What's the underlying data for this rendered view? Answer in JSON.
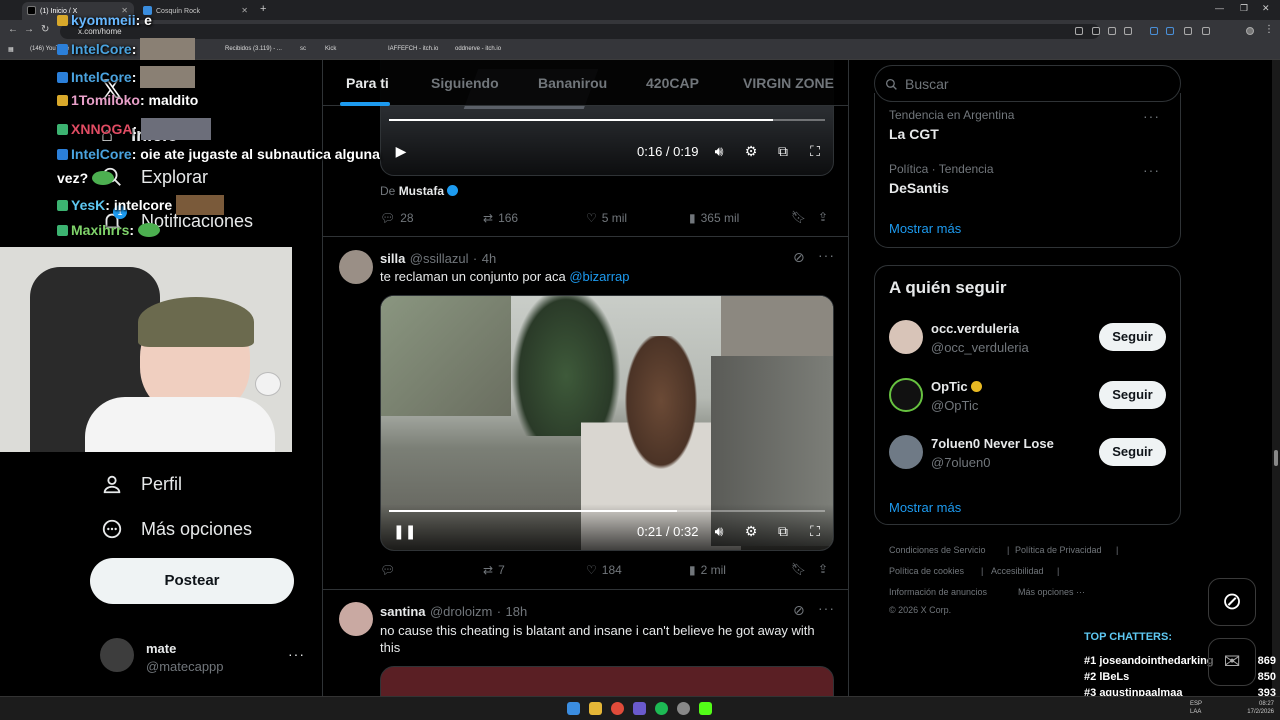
{
  "browser": {
    "tabs": [
      {
        "label": "(1) Inicio / X",
        "active": true
      },
      {
        "label": "Cosquín Rock",
        "active": false
      }
    ],
    "url": "x.com/home",
    "bookmarks": [
      "(146) YouTube",
      "Recibidos (3.119) - ...",
      "sc",
      "Kick",
      "IAFFEFCH - itch.io",
      "oddnerve - itch.io"
    ]
  },
  "chat_overlay": {
    "lines": [
      {
        "user": "kyommeii",
        "msg": "e"
      },
      {
        "user": "IntelCore",
        "msg": ""
      },
      {
        "user": "IntelCore",
        "msg": ""
      },
      {
        "user": "1Tomiloko",
        "msg": "maldito"
      },
      {
        "user": "XNNOGA",
        "msg": ""
      },
      {
        "user": "IntelCore",
        "msg": "oie ate jugaste al subnautica alguna"
      },
      {
        "user": "",
        "msg": "vez?"
      },
      {
        "user": "YesK",
        "msg": "intelcore"
      },
      {
        "user": "Maxihrrs",
        "msg": ""
      }
    ]
  },
  "left_nav": {
    "items": [
      {
        "label": "Inicio"
      },
      {
        "label": "Explorar"
      },
      {
        "label": "Notificaciones",
        "badge": "1"
      },
      {
        "label": "Perfil"
      },
      {
        "label": "Más opciones"
      }
    ],
    "post_button": "Postear",
    "account": {
      "name": "mate",
      "handle": "@matecappp"
    }
  },
  "feed_tabs": [
    "Para ti",
    "Siguiendo",
    "Bananirou",
    "420CAP",
    "VIRGIN ZONE"
  ],
  "tweets": [
    {
      "source": "De",
      "source_name": "Mustafa",
      "video": {
        "time": "0:16 / 0:19",
        "progress": 0.88
      },
      "replies": "28",
      "reposts": "166",
      "likes": "5 mil",
      "views": "365 mil"
    },
    {
      "name": "silla",
      "handle": "@ssillazul",
      "time": "4h",
      "text": "te reclaman un conjunto por aca ",
      "mention": "@bizarrap",
      "video": {
        "time": "0:21 / 0:32",
        "progress": 0.66
      },
      "replies": "",
      "reposts": "7",
      "likes": "184",
      "views": "2 mil"
    },
    {
      "name": "santina",
      "handle": "@droloizm",
      "time": "18h",
      "text": "no cause this cheating is blatant and insane i can't believe he got away with this"
    }
  ],
  "right_sidebar": {
    "search_placeholder": "Buscar",
    "trends": [
      {
        "meta": "Tendencia en Argentina",
        "name": "La CGT"
      },
      {
        "meta": "Política · Tendencia",
        "name": "DeSantis"
      }
    ],
    "show_more": "Mostrar más",
    "who_to_follow_title": "A quién seguir",
    "suggestions": [
      {
        "name": "occ.verduleria",
        "handle": "@occ_verduleria",
        "verified": false
      },
      {
        "name": "OpTic",
        "handle": "@OpTic",
        "verified": true
      },
      {
        "name": "7oluen0 Never Lose",
        "handle": "@7oluen0",
        "verified": false
      }
    ],
    "follow_label": "Seguir",
    "footer": [
      "Condiciones de Servicio",
      "|",
      "Política de Privacidad",
      "|",
      "Política de cookies",
      "|",
      "Accesibilidad",
      "|",
      "Información de anuncios",
      "Más opciones ···",
      "© 2026 X Corp."
    ]
  },
  "top_chatters": {
    "title": "TOP CHATTERS:",
    "rows": [
      {
        "rank": "#1",
        "name": "joseandointhedarking",
        "count": "869"
      },
      {
        "rank": "#2",
        "name": "lBeLs",
        "count": "850"
      },
      {
        "rank": "#3",
        "name": "agustinpaalmaa",
        "count": "393"
      }
    ]
  },
  "taskbar": {
    "lang": "ESP\nLAA",
    "time": "08:27",
    "date": "17/2/2026"
  },
  "colors": {
    "accent": "#1d9bf0",
    "bg": "#000000",
    "border": "#2f3336",
    "muted": "#71767b"
  }
}
